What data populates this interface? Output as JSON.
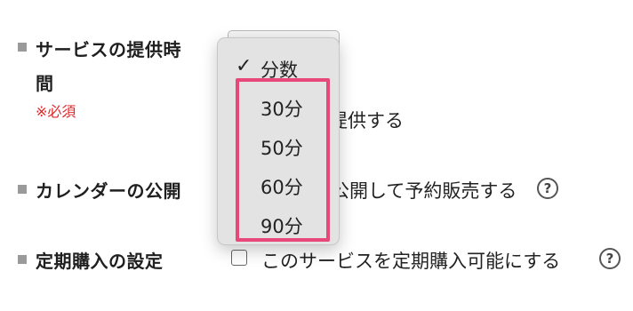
{
  "rows": {
    "service_time": {
      "label_line1": "サービスの提供時",
      "label_line2": "間",
      "required": "※必須",
      "behind_text": "提供する"
    },
    "calendar": {
      "label": "カレンダーの公開",
      "behind_text": "公開して予約販売する",
      "help": "?"
    },
    "subscription": {
      "label": "定期購入の設定",
      "checkbox_label": "このサービスを定期購入可能にする",
      "help": "?"
    }
  },
  "dropdown": {
    "selected": "分数",
    "options": [
      "30分",
      "50分",
      "60分",
      "90分"
    ],
    "check_glyph": "✓"
  },
  "colors": {
    "accent_highlight": "#e8477a",
    "required_red": "#e0262a"
  }
}
